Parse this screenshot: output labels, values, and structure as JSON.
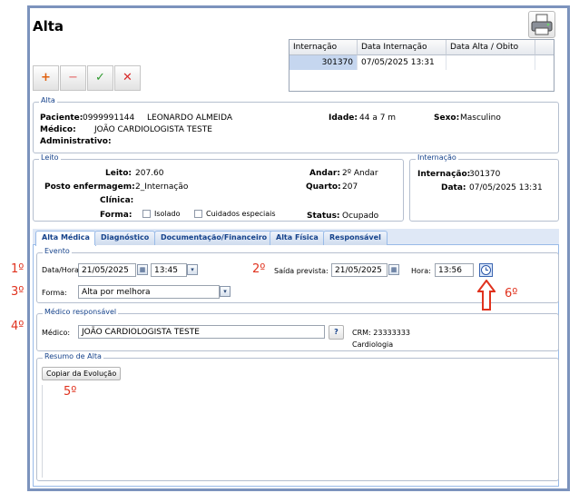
{
  "window": {
    "title": "Alta"
  },
  "toolbar": {
    "add": "+",
    "remove": "−",
    "confirm": "✓",
    "cancel": "✕"
  },
  "grid": {
    "headers": [
      "Internação",
      "Data Internação",
      "Data Alta / Obito"
    ],
    "row": {
      "internacao": "301370",
      "data_internacao": "07/05/2025 13:31",
      "data_alta": ""
    }
  },
  "alta": {
    "legend": "Alta",
    "paciente_label": "Paciente:",
    "paciente_codigo": "0999991144",
    "paciente_nome": "LEONARDO ALMEIDA",
    "medico_label": "Médico:",
    "medico": "JOÃO CARDIOLOGISTA TESTE",
    "administrativo_label": "Administrativo:",
    "idade_label": "Idade:",
    "idade": "44 a 7 m",
    "sexo_label": "Sexo:",
    "sexo": "Masculino"
  },
  "leito": {
    "legend": "Leito",
    "leito_label": "Leito:",
    "leito": "207.60",
    "posto_label": "Posto enfermagem:",
    "posto": "2_Internação",
    "clinica_label": "Clínica:",
    "forma_label": "Forma:",
    "isolado": "Isolado",
    "cuidados": "Cuidados especiais",
    "andar_label": "Andar:",
    "andar": "2º Andar",
    "quarto_label": "Quarto:",
    "quarto": "207",
    "status_label": "Status:",
    "status": "Ocupado"
  },
  "internacao": {
    "legend": "Internação",
    "internacao_label": "Internação:",
    "internacao": "301370",
    "data_label": "Data:",
    "data": "07/05/2025 13:31"
  },
  "tabs": [
    "Alta Médica",
    "Diagnóstico",
    "Documentação/Financeiro",
    "Alta Física",
    "Responsável"
  ],
  "evento": {
    "legend": "Evento",
    "datahora_label": "Data/Hora:",
    "data": "21/05/2025",
    "hora": "13:45",
    "saida_label": "Saída prevista:",
    "saida_data": "21/05/2025",
    "hora_label": "Hora:",
    "saida_hora": "13:56",
    "forma_label": "Forma:",
    "forma": "Alta por melhora"
  },
  "medico_resp": {
    "legend": "Médico responsável",
    "medico_label": "Médico:",
    "medico": "JOÃO CARDIOLOGISTA TESTE",
    "help": "?",
    "crm": "CRM: 23333333",
    "especialidade": "Cardiologia"
  },
  "resumo": {
    "legend": "Resumo de Alta",
    "copiar": "Copiar da Evolução"
  },
  "annotations": {
    "a1": "1º",
    "a2": "2º",
    "a3": "3º",
    "a4": "4º",
    "a5": "5º",
    "a6": "6º"
  },
  "colors": {
    "accent": "#15428b",
    "annotation": "#e0321e",
    "frame": "#7c93bd"
  }
}
